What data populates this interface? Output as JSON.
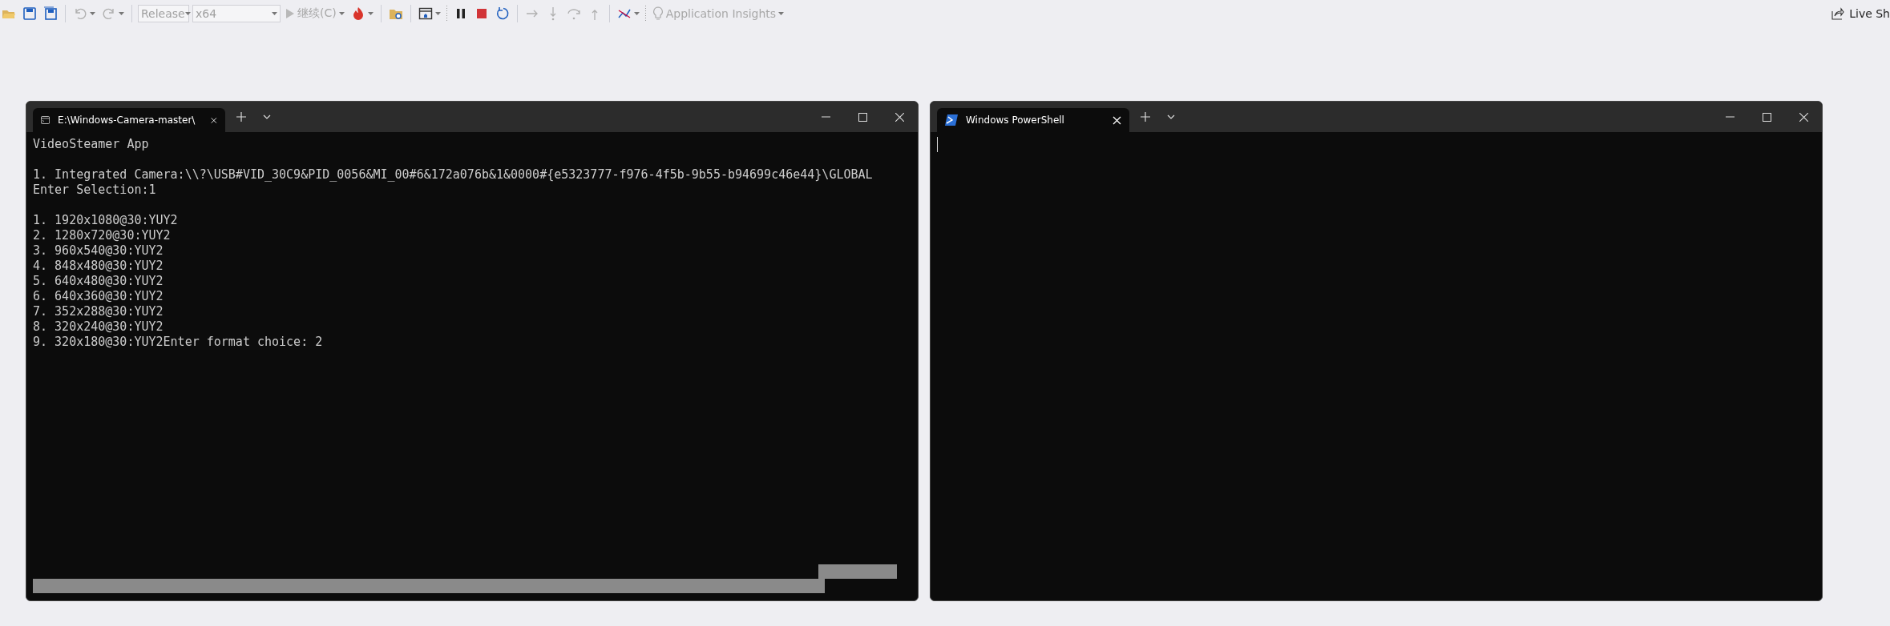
{
  "toolbar": {
    "config": "Release",
    "platform": "x64",
    "continue": "继续(C)",
    "insights": "Application Insights",
    "live_share": "Live Sh"
  },
  "terminals": [
    {
      "tab": "E:\\Windows-Camera-master\\",
      "kind": "cmd",
      "paragraphs": [
        [
          "VideoSteamer App"
        ],
        [
          "1. Integrated Camera:\\\\?\\USB#VID_30C9&PID_0056&MI_00#6&172a076b&1&0000#{e5323777-f976-4f5b-9b55-b94699c46e44}\\GLOBAL",
          "Enter Selection:1"
        ],
        [
          "1. 1920x1080@30:YUY2",
          "2. 1280x720@30:YUY2",
          "3. 960x540@30:YUY2",
          "4. 848x480@30:YUY2",
          "5. 640x480@30:YUY2",
          "6. 640x360@30:YUY2",
          "7. 352x288@30:YUY2",
          "8. 320x240@30:YUY2",
          "9. 320x180@30:YUY2Enter format choice: 2"
        ]
      ],
      "cursor": false,
      "artifacts": true
    },
    {
      "tab": "Windows PowerShell",
      "kind": "powershell",
      "cursor": true,
      "artifacts": false
    }
  ]
}
